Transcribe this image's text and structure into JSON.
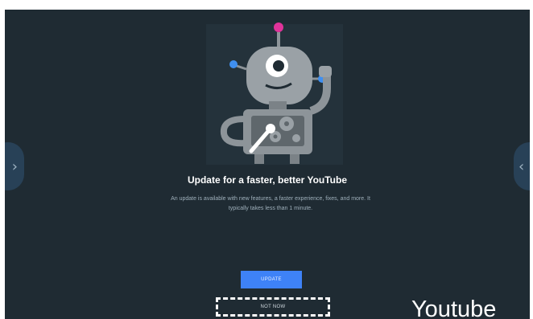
{
  "dialog": {
    "title": "Update for a faster, better YouTube",
    "description": "An update is available with new features, a faster experience, fixes, and more. It typically takes less than 1 minute.",
    "update_label": "UPDATE",
    "not_now_label": "NOT NOW"
  },
  "nav": {
    "prev_icon": "chevron-right-icon",
    "next_icon": "chevron-left-icon",
    "prev_glyph": "›",
    "next_glyph": "‹"
  },
  "caption": "Youtube",
  "colors": {
    "background": "#1f2b33",
    "accent": "#3e82f7",
    "robot_body": "#8d9499",
    "antenna_top": "#e0339a",
    "ear_dots": "#3f8ff0"
  }
}
